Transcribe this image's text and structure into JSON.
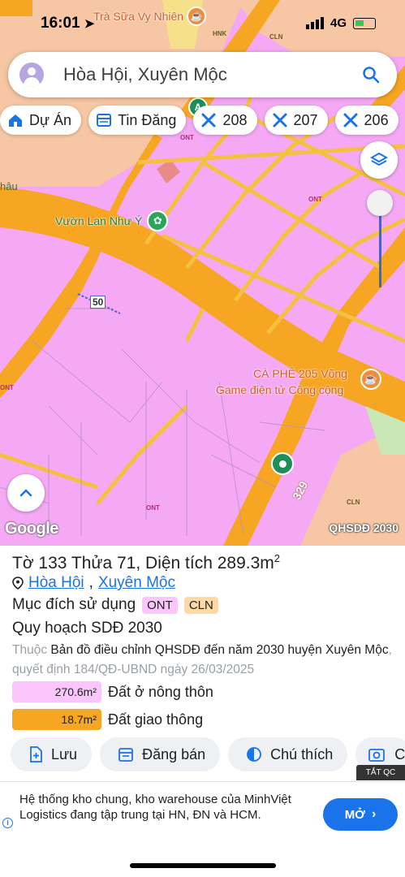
{
  "status_bar": {
    "time": "16:01",
    "network": "4G"
  },
  "search": {
    "value": "Hòa Hội, Xuyên Mộc"
  },
  "chips": [
    {
      "label": "Dự Án",
      "icon": "house-icon"
    },
    {
      "label": "Tin Đăng",
      "icon": "listing-icon"
    },
    {
      "label": "208",
      "icon": "tools-icon"
    },
    {
      "label": "207",
      "icon": "tools-icon"
    },
    {
      "label": "206",
      "icon": "tools-icon"
    }
  ],
  "map": {
    "labels": {
      "cafe_top": "Trà Sữa Vy Nhiên",
      "hnk": "HNK",
      "cln_top": "CLN",
      "ont_1": "ONT",
      "ont_2": "ONT",
      "ont_3": "ONT",
      "ont_4": "ONT",
      "hau": "hâu",
      "garden": "Vườn Lan Như Ý",
      "road_50": "50",
      "cafe_205_line1": "CÀ PHÊ 205 Võng",
      "cafe_205_line2": "Game điện tử Công cộng",
      "road_329": "329",
      "cln_bottom": "CLN"
    },
    "google": "Google",
    "layer_name": "QHSDĐ 2030"
  },
  "sheet": {
    "title_prefix": "Tờ 133 Thửa 71, Diện tích 289.3m",
    "title_sup": "2",
    "commune": "Hòa Hội",
    "district": "Xuyên Mộc",
    "purpose_label": "Mục đích sử dụng",
    "purpose_badges": [
      {
        "code": "ONT",
        "bg": "#fbc6fb"
      },
      {
        "code": "CLN",
        "bg": "#fdd9a8"
      }
    ],
    "plan_label": "Quy hoạch SDĐ 2030",
    "desc_prefix": "Thuộc",
    "desc_main": "Bản đồ điều chỉnh QHSDĐ đến năm 2030 huyện Xuyên Mộc",
    "desc_suffix": ", quyết định 184/QĐ-UBND ngày 26/03/2025",
    "areas": [
      {
        "value": "270.6m²",
        "label": "Đất ở nông thôn",
        "color": "#fbc6fb"
      },
      {
        "value": "18.7m²",
        "label": "Đất giao thông",
        "color": "#f6a623"
      }
    ]
  },
  "actions": [
    {
      "label": "Lưu",
      "icon": "save-icon"
    },
    {
      "label": "Đăng bán",
      "icon": "calendar-icon"
    },
    {
      "label": "Chú thích",
      "icon": "legend-icon"
    },
    {
      "label": "C",
      "icon": "camera-icon"
    }
  ],
  "ad": {
    "close_label": "TẮT QC",
    "text": "Hệ thống kho chung, kho warehouse của MinhViệt Logistics đang tập trung tại HN, ĐN và HCM.",
    "button": "MỞ"
  }
}
